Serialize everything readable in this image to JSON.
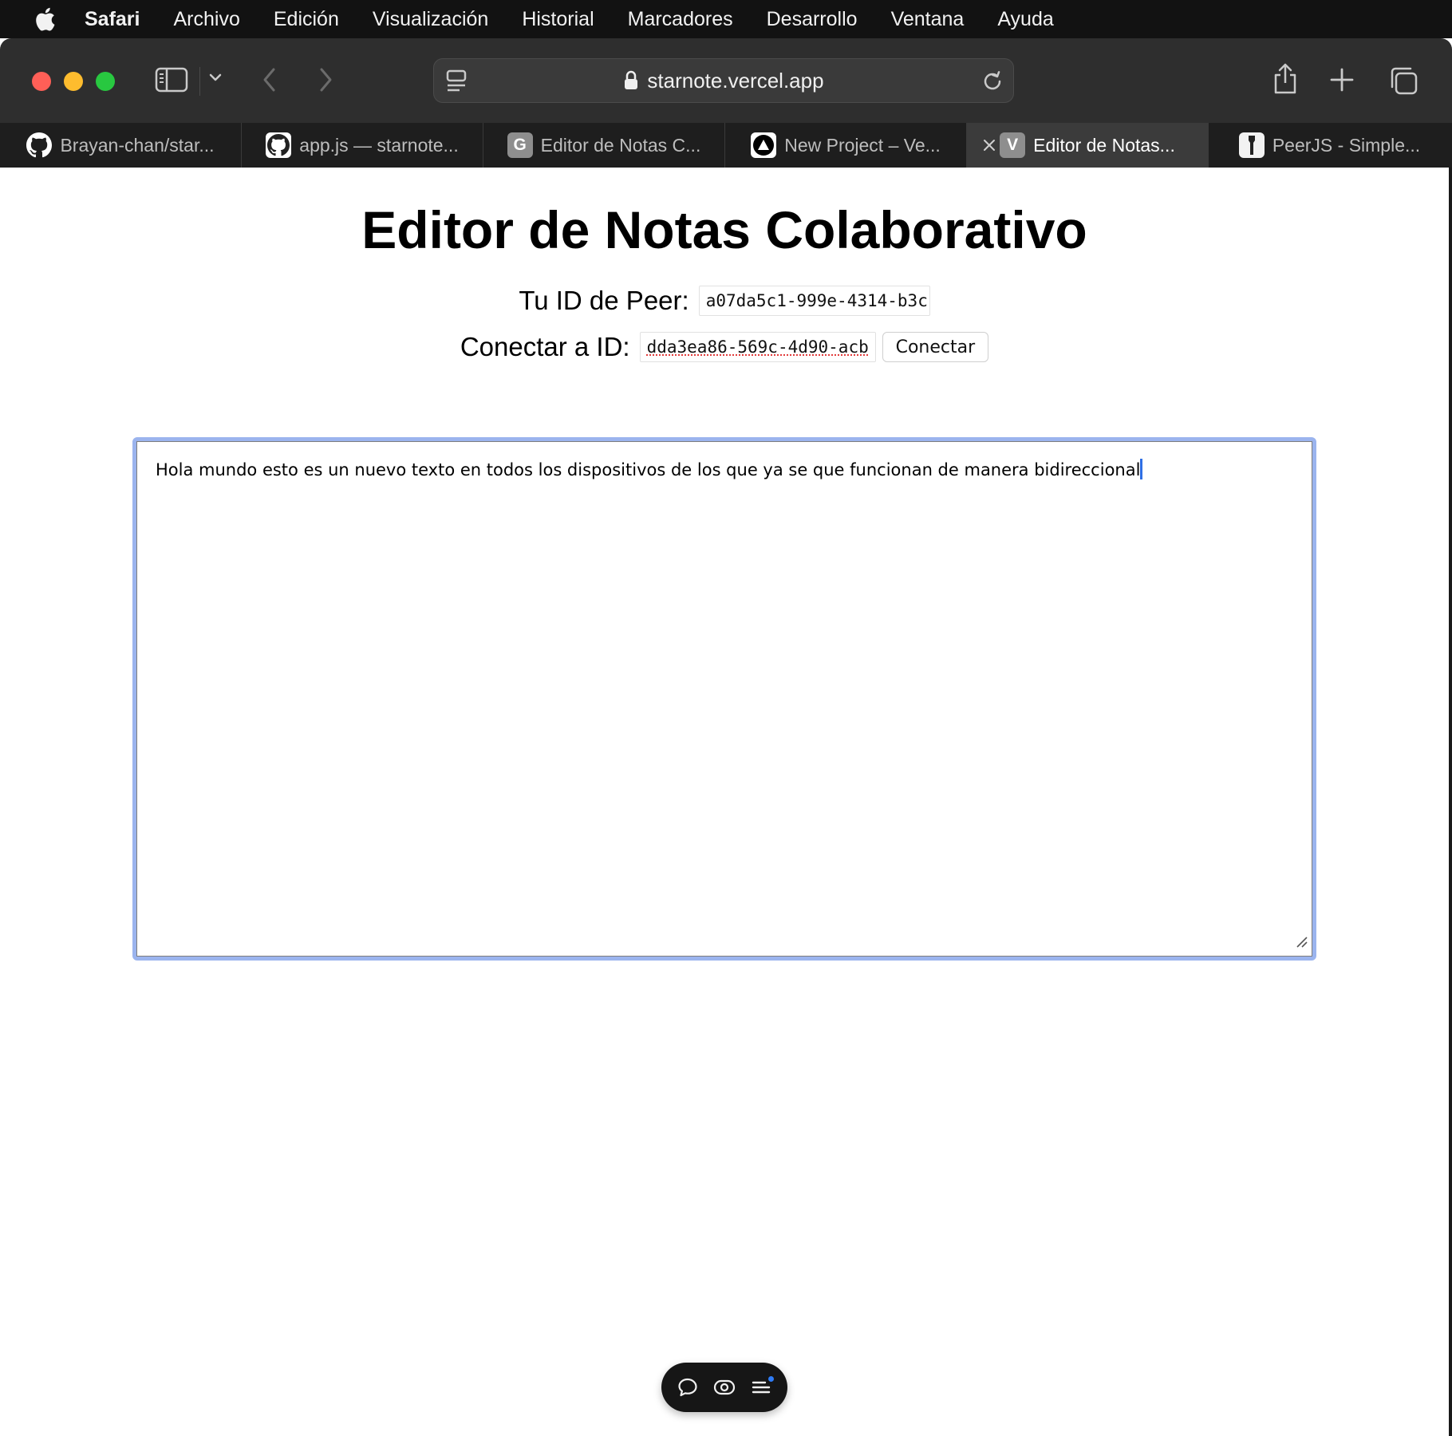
{
  "menubar": {
    "app": "Safari",
    "items": [
      "Archivo",
      "Edición",
      "Visualización",
      "Historial",
      "Marcadores",
      "Desarrollo",
      "Ventana",
      "Ayuda"
    ]
  },
  "toolbar": {
    "url": "starnote.vercel.app"
  },
  "tabs": [
    {
      "title": "Brayan-chan/star...",
      "favicon": "github-icon"
    },
    {
      "title": "app.js — starnote...",
      "favicon": "github-icon"
    },
    {
      "title": "Editor de Notas C...",
      "favicon": "letter-g-icon",
      "letter": "G"
    },
    {
      "title": "New Project – Ve...",
      "favicon": "vercel-icon"
    },
    {
      "title": "Editor de Notas...",
      "favicon": "letter-v-icon",
      "letter": "V",
      "active": true
    },
    {
      "title": "PeerJS - Simple...",
      "favicon": "peerjs-icon"
    }
  ],
  "page": {
    "title": "Editor de Notas Colaborativo",
    "peer_label": "Tu ID de Peer:",
    "peer_id": "a07da5c1-999e-4314-b3c",
    "connect_label": "Conectar a ID:",
    "connect_value": "dda3ea86-569c-4d90-acb",
    "connect_button": "Conectar",
    "editor_text": "Hola mundo esto es un nuevo texto en todos los dispositivos de los que ya se que funcionan de manera bidireccional"
  },
  "colors": {
    "menubar_bg": "#121212",
    "toolbar_bg": "#2e2e2e",
    "tabbar_bg": "#1e1e1e",
    "active_tab_bg": "#3b3b3b",
    "editor_focus_ring": "#9bb4ee",
    "caret": "#2f6fe4"
  }
}
